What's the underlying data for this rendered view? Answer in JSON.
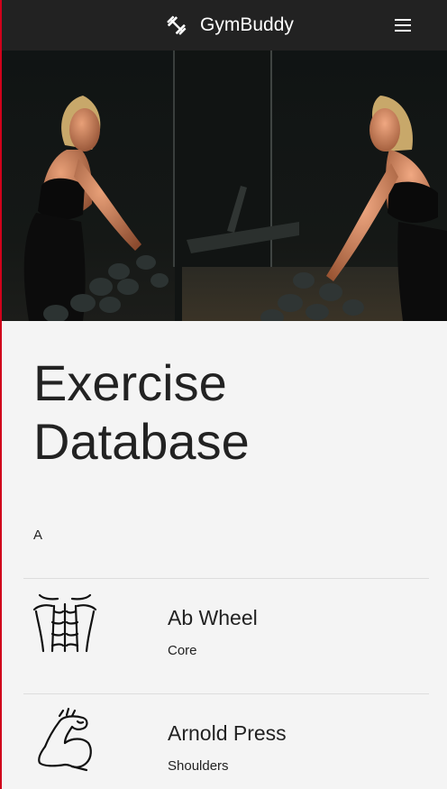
{
  "navbar": {
    "brand_icon": "dumbbell-icon",
    "brand_name": "GymBuddy",
    "menu_icon": "hamburger-menu-icon"
  },
  "hero": {
    "image": "woman-lifting-dumbbells-mirror-photo"
  },
  "main": {
    "title": "Exercise Database",
    "sections": [
      {
        "letter": "A",
        "exercises": [
          {
            "name": "Ab Wheel",
            "category": "Core",
            "icon": "abs-icon"
          },
          {
            "name": "Arnold Press",
            "category": "Shoulders",
            "icon": "flexed-bicep-icon"
          }
        ]
      }
    ]
  },
  "colors": {
    "navbar_bg": "#222222",
    "page_bg": "#f4f4f4",
    "text": "#222222",
    "accent_edge": "#d0021b"
  }
}
